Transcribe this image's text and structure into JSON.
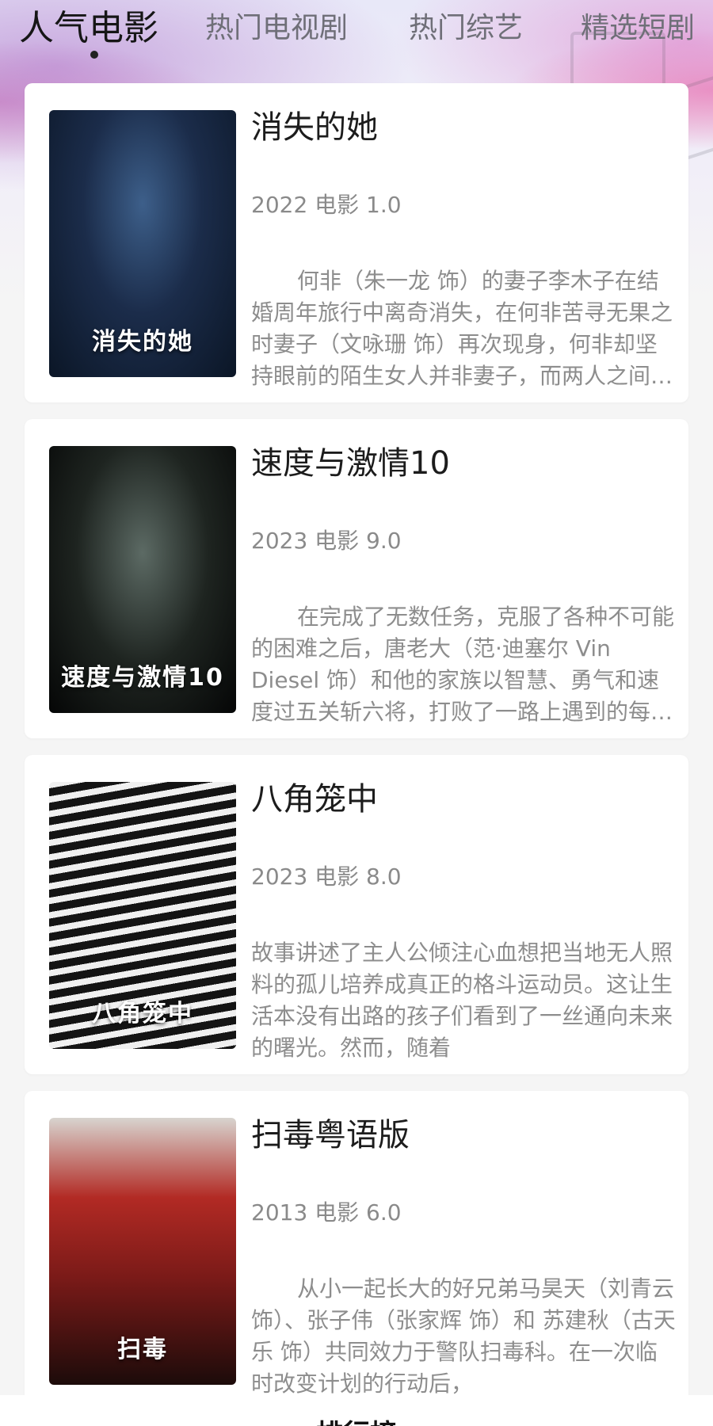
{
  "tabs": [
    {
      "label": "人气电影"
    },
    {
      "label": "热门电视剧"
    },
    {
      "label": "热门综艺"
    },
    {
      "label": "精选短剧"
    }
  ],
  "movies": [
    {
      "title": "消失的她",
      "meta": "2022 电影 1.0",
      "desc": "何非（朱一龙 饰）的妻子李木子在结婚周年旅行中离奇消失，在何非苦寻无果之时妻子（文咏珊 饰）再次现身，何非却坚持眼前的陌生女人并非妻子，而两人之间又陷入了种种谜团之中",
      "poster_text": "消失的她",
      "poster_colors": [
        "#1b2c4a",
        "#0b1626"
      ]
    },
    {
      "title": "速度与激情10",
      "meta": "2023 电影 9.0",
      "desc": "在完成了无数任务，克服了各种不可能的困难之后，唐老大（范·迪塞尔 Vin Diesel 饰）和他的家族以智慧、勇气和速度过五关斩六将，打败了一路上遇到的每一个敌人",
      "poster_text": "速度与激情10",
      "poster_colors": [
        "#1e2420",
        "#050606"
      ]
    },
    {
      "title": "八角笼中",
      "meta": "2023 电影 8.0",
      "desc": "故事讲述了主人公倾注心血想把当地无人照料的孤儿培养成真正的格斗运动员。这让生活本没有出路的孩子们看到了一丝通向未来的曙光。然而，随着",
      "poster_text": "八角笼中",
      "poster_colors": [
        "#3a3a3a",
        "#111111"
      ]
    },
    {
      "title": "扫毒粤语版",
      "meta": "2013 电影 6.0",
      "desc": "从小一起长大的好兄弟马昊天（刘青云 饰）、张子伟（张家辉 饰）和 苏建秋（古天乐 饰）共同效力于警队扫毒科。在一次临时改变计划的行动后，",
      "poster_text": "扫毒",
      "poster_colors": [
        "#7a1a18",
        "#1c0b0a"
      ]
    }
  ],
  "bottom_nav": {
    "label": "排行榜"
  }
}
